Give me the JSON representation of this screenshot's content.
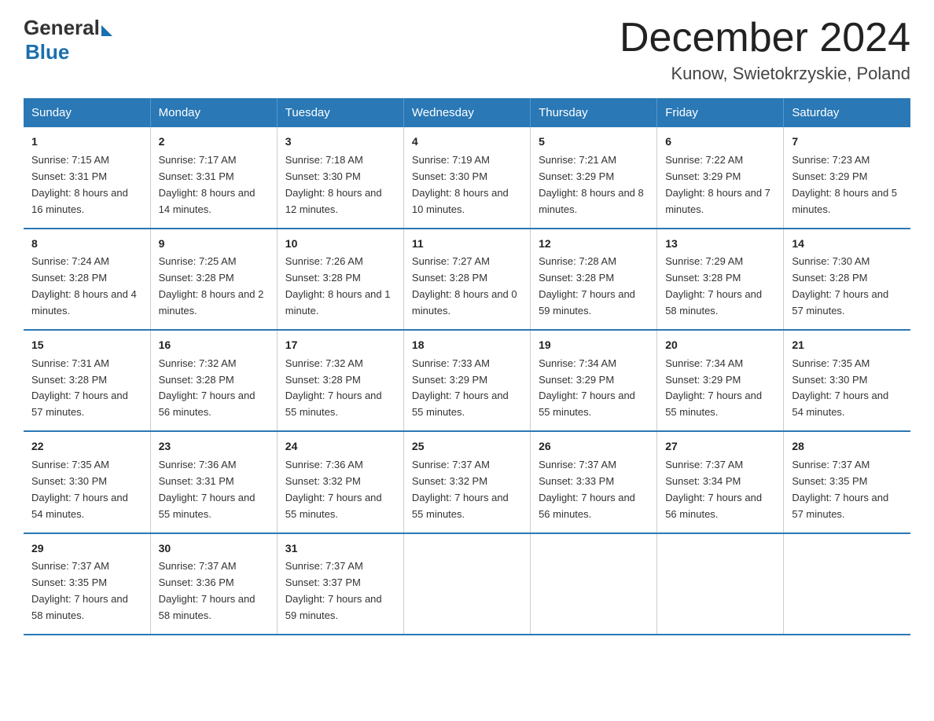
{
  "header": {
    "logo_general": "General",
    "logo_blue": "Blue",
    "month_title": "December 2024",
    "location": "Kunow, Swietokrzyskie, Poland"
  },
  "days_of_week": [
    "Sunday",
    "Monday",
    "Tuesday",
    "Wednesday",
    "Thursday",
    "Friday",
    "Saturday"
  ],
  "weeks": [
    [
      {
        "day": "1",
        "sunrise": "7:15 AM",
        "sunset": "3:31 PM",
        "daylight": "8 hours and 16 minutes."
      },
      {
        "day": "2",
        "sunrise": "7:17 AM",
        "sunset": "3:31 PM",
        "daylight": "8 hours and 14 minutes."
      },
      {
        "day": "3",
        "sunrise": "7:18 AM",
        "sunset": "3:30 PM",
        "daylight": "8 hours and 12 minutes."
      },
      {
        "day": "4",
        "sunrise": "7:19 AM",
        "sunset": "3:30 PM",
        "daylight": "8 hours and 10 minutes."
      },
      {
        "day": "5",
        "sunrise": "7:21 AM",
        "sunset": "3:29 PM",
        "daylight": "8 hours and 8 minutes."
      },
      {
        "day": "6",
        "sunrise": "7:22 AM",
        "sunset": "3:29 PM",
        "daylight": "8 hours and 7 minutes."
      },
      {
        "day": "7",
        "sunrise": "7:23 AM",
        "sunset": "3:29 PM",
        "daylight": "8 hours and 5 minutes."
      }
    ],
    [
      {
        "day": "8",
        "sunrise": "7:24 AM",
        "sunset": "3:28 PM",
        "daylight": "8 hours and 4 minutes."
      },
      {
        "day": "9",
        "sunrise": "7:25 AM",
        "sunset": "3:28 PM",
        "daylight": "8 hours and 2 minutes."
      },
      {
        "day": "10",
        "sunrise": "7:26 AM",
        "sunset": "3:28 PM",
        "daylight": "8 hours and 1 minute."
      },
      {
        "day": "11",
        "sunrise": "7:27 AM",
        "sunset": "3:28 PM",
        "daylight": "8 hours and 0 minutes."
      },
      {
        "day": "12",
        "sunrise": "7:28 AM",
        "sunset": "3:28 PM",
        "daylight": "7 hours and 59 minutes."
      },
      {
        "day": "13",
        "sunrise": "7:29 AM",
        "sunset": "3:28 PM",
        "daylight": "7 hours and 58 minutes."
      },
      {
        "day": "14",
        "sunrise": "7:30 AM",
        "sunset": "3:28 PM",
        "daylight": "7 hours and 57 minutes."
      }
    ],
    [
      {
        "day": "15",
        "sunrise": "7:31 AM",
        "sunset": "3:28 PM",
        "daylight": "7 hours and 57 minutes."
      },
      {
        "day": "16",
        "sunrise": "7:32 AM",
        "sunset": "3:28 PM",
        "daylight": "7 hours and 56 minutes."
      },
      {
        "day": "17",
        "sunrise": "7:32 AM",
        "sunset": "3:28 PM",
        "daylight": "7 hours and 55 minutes."
      },
      {
        "day": "18",
        "sunrise": "7:33 AM",
        "sunset": "3:29 PM",
        "daylight": "7 hours and 55 minutes."
      },
      {
        "day": "19",
        "sunrise": "7:34 AM",
        "sunset": "3:29 PM",
        "daylight": "7 hours and 55 minutes."
      },
      {
        "day": "20",
        "sunrise": "7:34 AM",
        "sunset": "3:29 PM",
        "daylight": "7 hours and 55 minutes."
      },
      {
        "day": "21",
        "sunrise": "7:35 AM",
        "sunset": "3:30 PM",
        "daylight": "7 hours and 54 minutes."
      }
    ],
    [
      {
        "day": "22",
        "sunrise": "7:35 AM",
        "sunset": "3:30 PM",
        "daylight": "7 hours and 54 minutes."
      },
      {
        "day": "23",
        "sunrise": "7:36 AM",
        "sunset": "3:31 PM",
        "daylight": "7 hours and 55 minutes."
      },
      {
        "day": "24",
        "sunrise": "7:36 AM",
        "sunset": "3:32 PM",
        "daylight": "7 hours and 55 minutes."
      },
      {
        "day": "25",
        "sunrise": "7:37 AM",
        "sunset": "3:32 PM",
        "daylight": "7 hours and 55 minutes."
      },
      {
        "day": "26",
        "sunrise": "7:37 AM",
        "sunset": "3:33 PM",
        "daylight": "7 hours and 56 minutes."
      },
      {
        "day": "27",
        "sunrise": "7:37 AM",
        "sunset": "3:34 PM",
        "daylight": "7 hours and 56 minutes."
      },
      {
        "day": "28",
        "sunrise": "7:37 AM",
        "sunset": "3:35 PM",
        "daylight": "7 hours and 57 minutes."
      }
    ],
    [
      {
        "day": "29",
        "sunrise": "7:37 AM",
        "sunset": "3:35 PM",
        "daylight": "7 hours and 58 minutes."
      },
      {
        "day": "30",
        "sunrise": "7:37 AM",
        "sunset": "3:36 PM",
        "daylight": "7 hours and 58 minutes."
      },
      {
        "day": "31",
        "sunrise": "7:37 AM",
        "sunset": "3:37 PM",
        "daylight": "7 hours and 59 minutes."
      },
      null,
      null,
      null,
      null
    ]
  ],
  "labels": {
    "sunrise": "Sunrise:",
    "sunset": "Sunset:",
    "daylight": "Daylight:"
  }
}
